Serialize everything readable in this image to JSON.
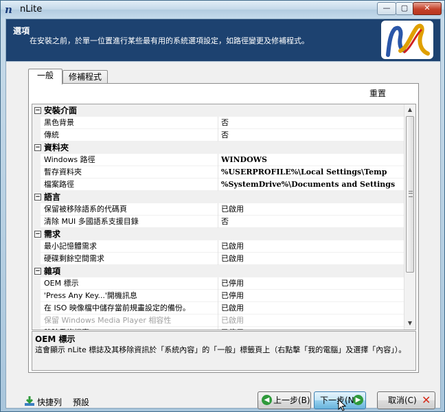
{
  "window": {
    "title": "nLite",
    "controls": {
      "minimize": "—",
      "maximize": "▢",
      "close": "✕"
    }
  },
  "header": {
    "title": "選項",
    "description": "在安裝之前，於單一位置進行某些最有用的系統選項設定，如路徑變更及修補程式。"
  },
  "tabs": [
    {
      "label": "一般",
      "active": true
    },
    {
      "label": "修補程式",
      "active": false
    }
  ],
  "reset_label": "重置",
  "grid": [
    {
      "type": "category",
      "toggle": "−",
      "label": "安裝介面"
    },
    {
      "type": "prop",
      "name": "黑色背景",
      "value": "否"
    },
    {
      "type": "prop",
      "name": "傳統",
      "value": "否"
    },
    {
      "type": "category",
      "toggle": "−",
      "label": "資料夾"
    },
    {
      "type": "prop",
      "name": "Windows 路徑",
      "value": "WINDOWS",
      "bold": true
    },
    {
      "type": "prop",
      "name": "暫存資料夾",
      "value": "%USERPROFILE%\\Local Settings\\Temp",
      "bold": true
    },
    {
      "type": "prop",
      "name": "檔案路徑",
      "value": "%SystemDrive%\\Documents and Settings",
      "bold": true
    },
    {
      "type": "category",
      "toggle": "−",
      "label": "語言"
    },
    {
      "type": "prop",
      "name": "保留被移除語系的代碼頁",
      "value": "已啟用"
    },
    {
      "type": "prop",
      "name": "清除 MUI 多國語系支援目錄",
      "value": "否"
    },
    {
      "type": "category",
      "toggle": "−",
      "label": "需求"
    },
    {
      "type": "prop",
      "name": "最小記憶體需求",
      "value": "已啟用"
    },
    {
      "type": "prop",
      "name": "硬碟剩餘空間需求",
      "value": "已啟用"
    },
    {
      "type": "category",
      "toggle": "−",
      "label": "雜項"
    },
    {
      "type": "prop",
      "name": "OEM 標示",
      "value": "已停用"
    },
    {
      "type": "prop",
      "name": "'Press Any Key...'開機訊息",
      "value": "已停用"
    },
    {
      "type": "prop",
      "name": "在 ISO 映像檔中儲存當前規畫設定的備份。",
      "value": "已啟用"
    },
    {
      "type": "prop",
      "name": "保留 Windows Media Player 相容性",
      "value": "已啟用",
      "dim": true
    },
    {
      "type": "prop",
      "name": "移除重複檔案",
      "value": "已停用"
    }
  ],
  "scrollbar": {
    "up": "▲",
    "down": "▼"
  },
  "help": {
    "title": "OEM 標示",
    "description": "這會顯示 nLite 標誌及其移除資訊於「系統內容」的「一般」標籤頁上（右點擊「我的電腦」及選擇「內容」）。"
  },
  "footer": {
    "shortcuts_label": "快捷列",
    "presets_label": "預設",
    "back_label": "上一步(B)",
    "next_label": "下一步(N)",
    "cancel_label": "取消(C)",
    "back_icon": "◀",
    "next_icon": "▶",
    "cancel_icon": "✕"
  }
}
